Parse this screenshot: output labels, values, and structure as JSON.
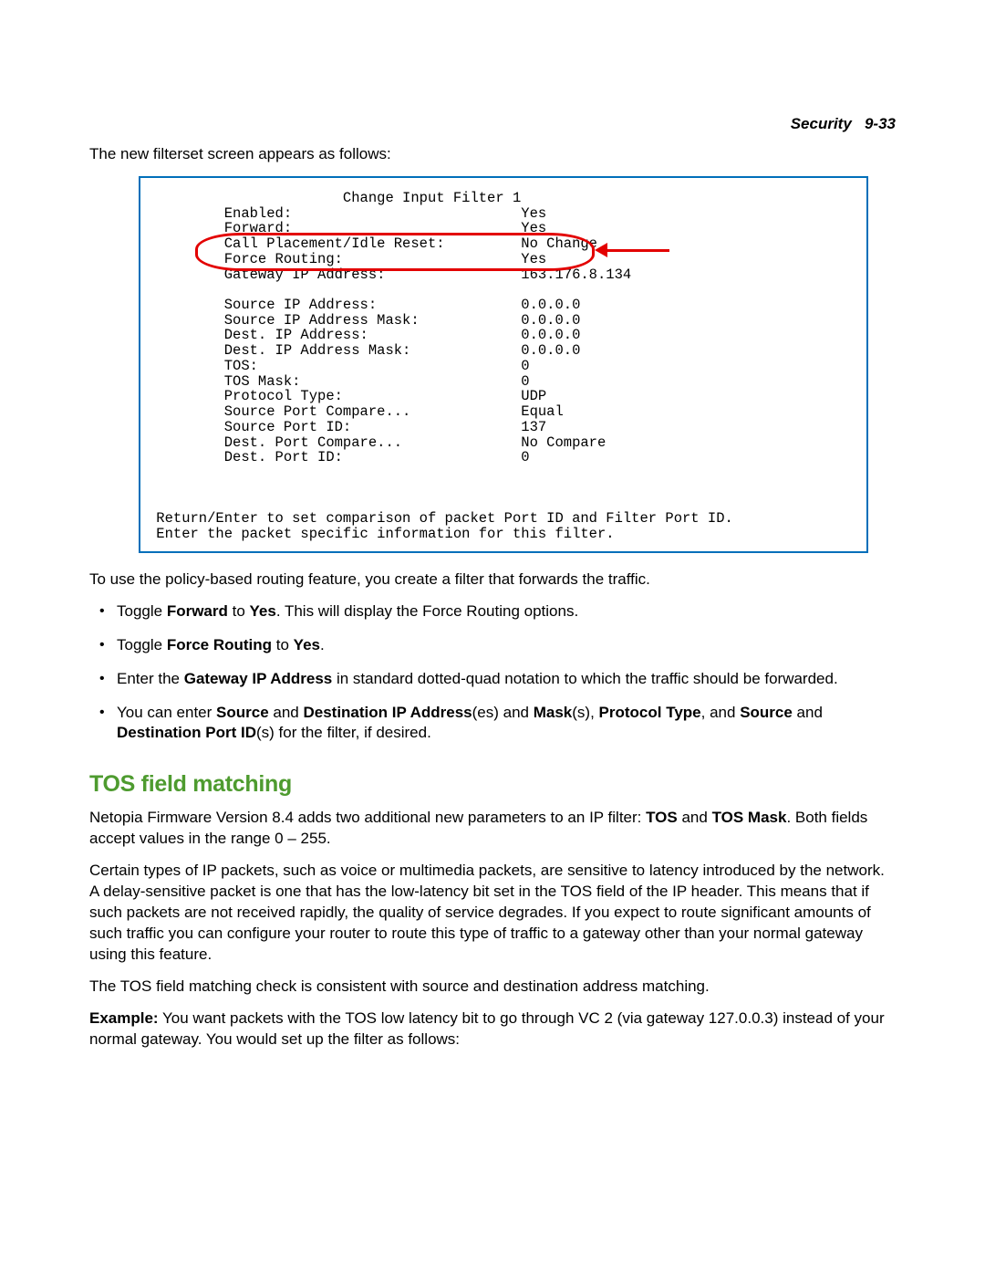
{
  "running_head": {
    "chapter": "Security",
    "page": "9-33"
  },
  "intro_line": "The new filterset screen appears as follows:",
  "screen": {
    "title": "Change Input Filter 1",
    "rows1": [
      {
        "label": "Enabled:",
        "value": "Yes"
      },
      {
        "label": "Forward:",
        "value": "Yes"
      },
      {
        "label": "Call Placement/Idle Reset:",
        "value": "No Change"
      },
      {
        "label": "Force Routing:",
        "value": "Yes"
      },
      {
        "label": "Gateway IP Address:",
        "value": "163.176.8.134"
      }
    ],
    "rows2": [
      {
        "label": "Source IP Address:",
        "value": "0.0.0.0"
      },
      {
        "label": "Source IP Address Mask:",
        "value": "0.0.0.0"
      },
      {
        "label": "Dest. IP Address:",
        "value": "0.0.0.0"
      },
      {
        "label": "Dest. IP Address Mask:",
        "value": "0.0.0.0"
      },
      {
        "label": "TOS:",
        "value": "0"
      },
      {
        "label": "TOS Mask:",
        "value": "0"
      },
      {
        "label": "Protocol Type:",
        "value": "UDP"
      },
      {
        "label": "Source Port Compare...",
        "value": "Equal"
      },
      {
        "label": "Source Port ID:",
        "value": "137"
      },
      {
        "label": "Dest. Port Compare...",
        "value": "No Compare"
      },
      {
        "label": "Dest. Port ID:",
        "value": "0"
      }
    ],
    "footer1": "Return/Enter to set comparison of packet Port ID and Filter Port ID.",
    "footer2": "Enter the packet specific information for this filter."
  },
  "policy_line": "To use the policy-based routing feature, you create a filter that forwards the traffic.",
  "bullets": {
    "b1a": "Toggle ",
    "b1b": "Forward",
    "b1c": " to ",
    "b1d": "Yes",
    "b1e": ". This will display the Force Routing options.",
    "b2a": "Toggle ",
    "b2b": "Force Routing",
    "b2c": " to ",
    "b2d": "Yes",
    "b2e": ".",
    "b3a": "Enter the ",
    "b3b": "Gateway IP Address",
    "b3c": " in standard dotted-quad notation to which the traffic should be forwarded.",
    "b4a": "You can enter ",
    "b4b": "Source",
    "b4c": " and ",
    "b4d": "Destination IP Address",
    "b4e": "(es) and ",
    "b4f": "Mask",
    "b4g": "(s), ",
    "b4h": "Protocol Type",
    "b4i": ", and ",
    "b4j": "Source",
    "b4k": " and ",
    "b4l": "Destination Port ID",
    "b4m": "(s) for the filter, if desired."
  },
  "heading": "TOS field matching",
  "p1a": "Netopia Firmware Version 8.4 adds two additional new parameters to an IP filter: ",
  "p1b": "TOS",
  "p1c": " and ",
  "p1d": "TOS Mask",
  "p1e": ". Both fields accept values in the range 0 – 255.",
  "p2": "Certain types of IP packets, such as voice or multimedia packets, are sensitive to latency introduced by the network. A delay-sensitive packet is one that has the low-latency bit set in the TOS field of the IP header. This means that if such packets are not received rapidly, the quality of service degrades. If you expect to route significant amounts of such traffic you can configure your router to route this type of traffic to a gateway other than your normal gateway using this feature.",
  "p3": "The TOS field matching check is consistent with source and destination address matching.",
  "p4a": "Example:",
  "p4b": "  You want packets with the TOS low latency bit to go through VC 2 (via gateway 127.0.0.3) instead of your normal gateway. You would set up the filter as follows:"
}
